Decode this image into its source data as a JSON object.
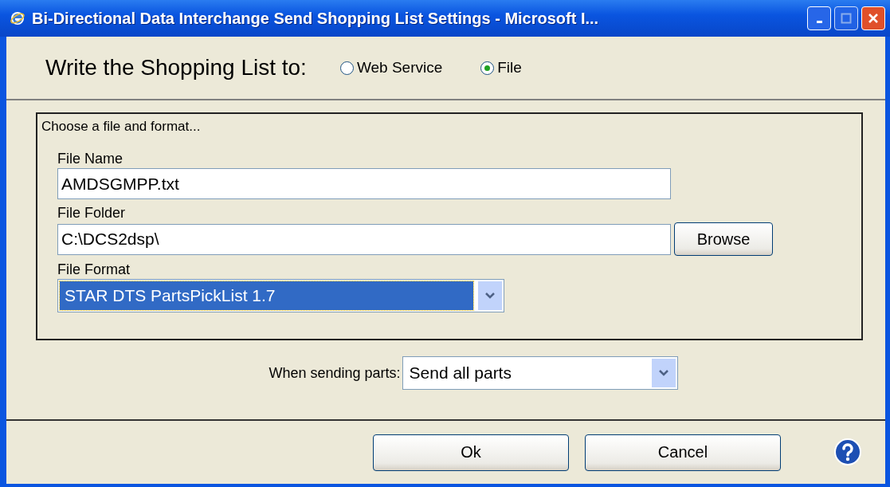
{
  "window": {
    "title": "Bi-Directional Data Interchange Send Shopping List Settings - Microsoft I..."
  },
  "destination": {
    "label": "Write the Shopping List to:",
    "options": [
      {
        "label": "Web Service",
        "selected": false
      },
      {
        "label": "File",
        "selected": true
      }
    ]
  },
  "file_group": {
    "title": "Choose a file and format...",
    "file_name": {
      "label": "File Name",
      "value": "AMDSGMPP.txt"
    },
    "file_folder": {
      "label": "File Folder",
      "value": "C:\\DCS2dsp\\",
      "browse": "Browse"
    },
    "file_format": {
      "label": "File Format",
      "value": "STAR DTS PartsPickList 1.7",
      "focused": true
    }
  },
  "sending": {
    "label": "When sending parts:",
    "value": "Send all parts"
  },
  "buttons": [
    "Ok",
    "Cancel"
  ]
}
